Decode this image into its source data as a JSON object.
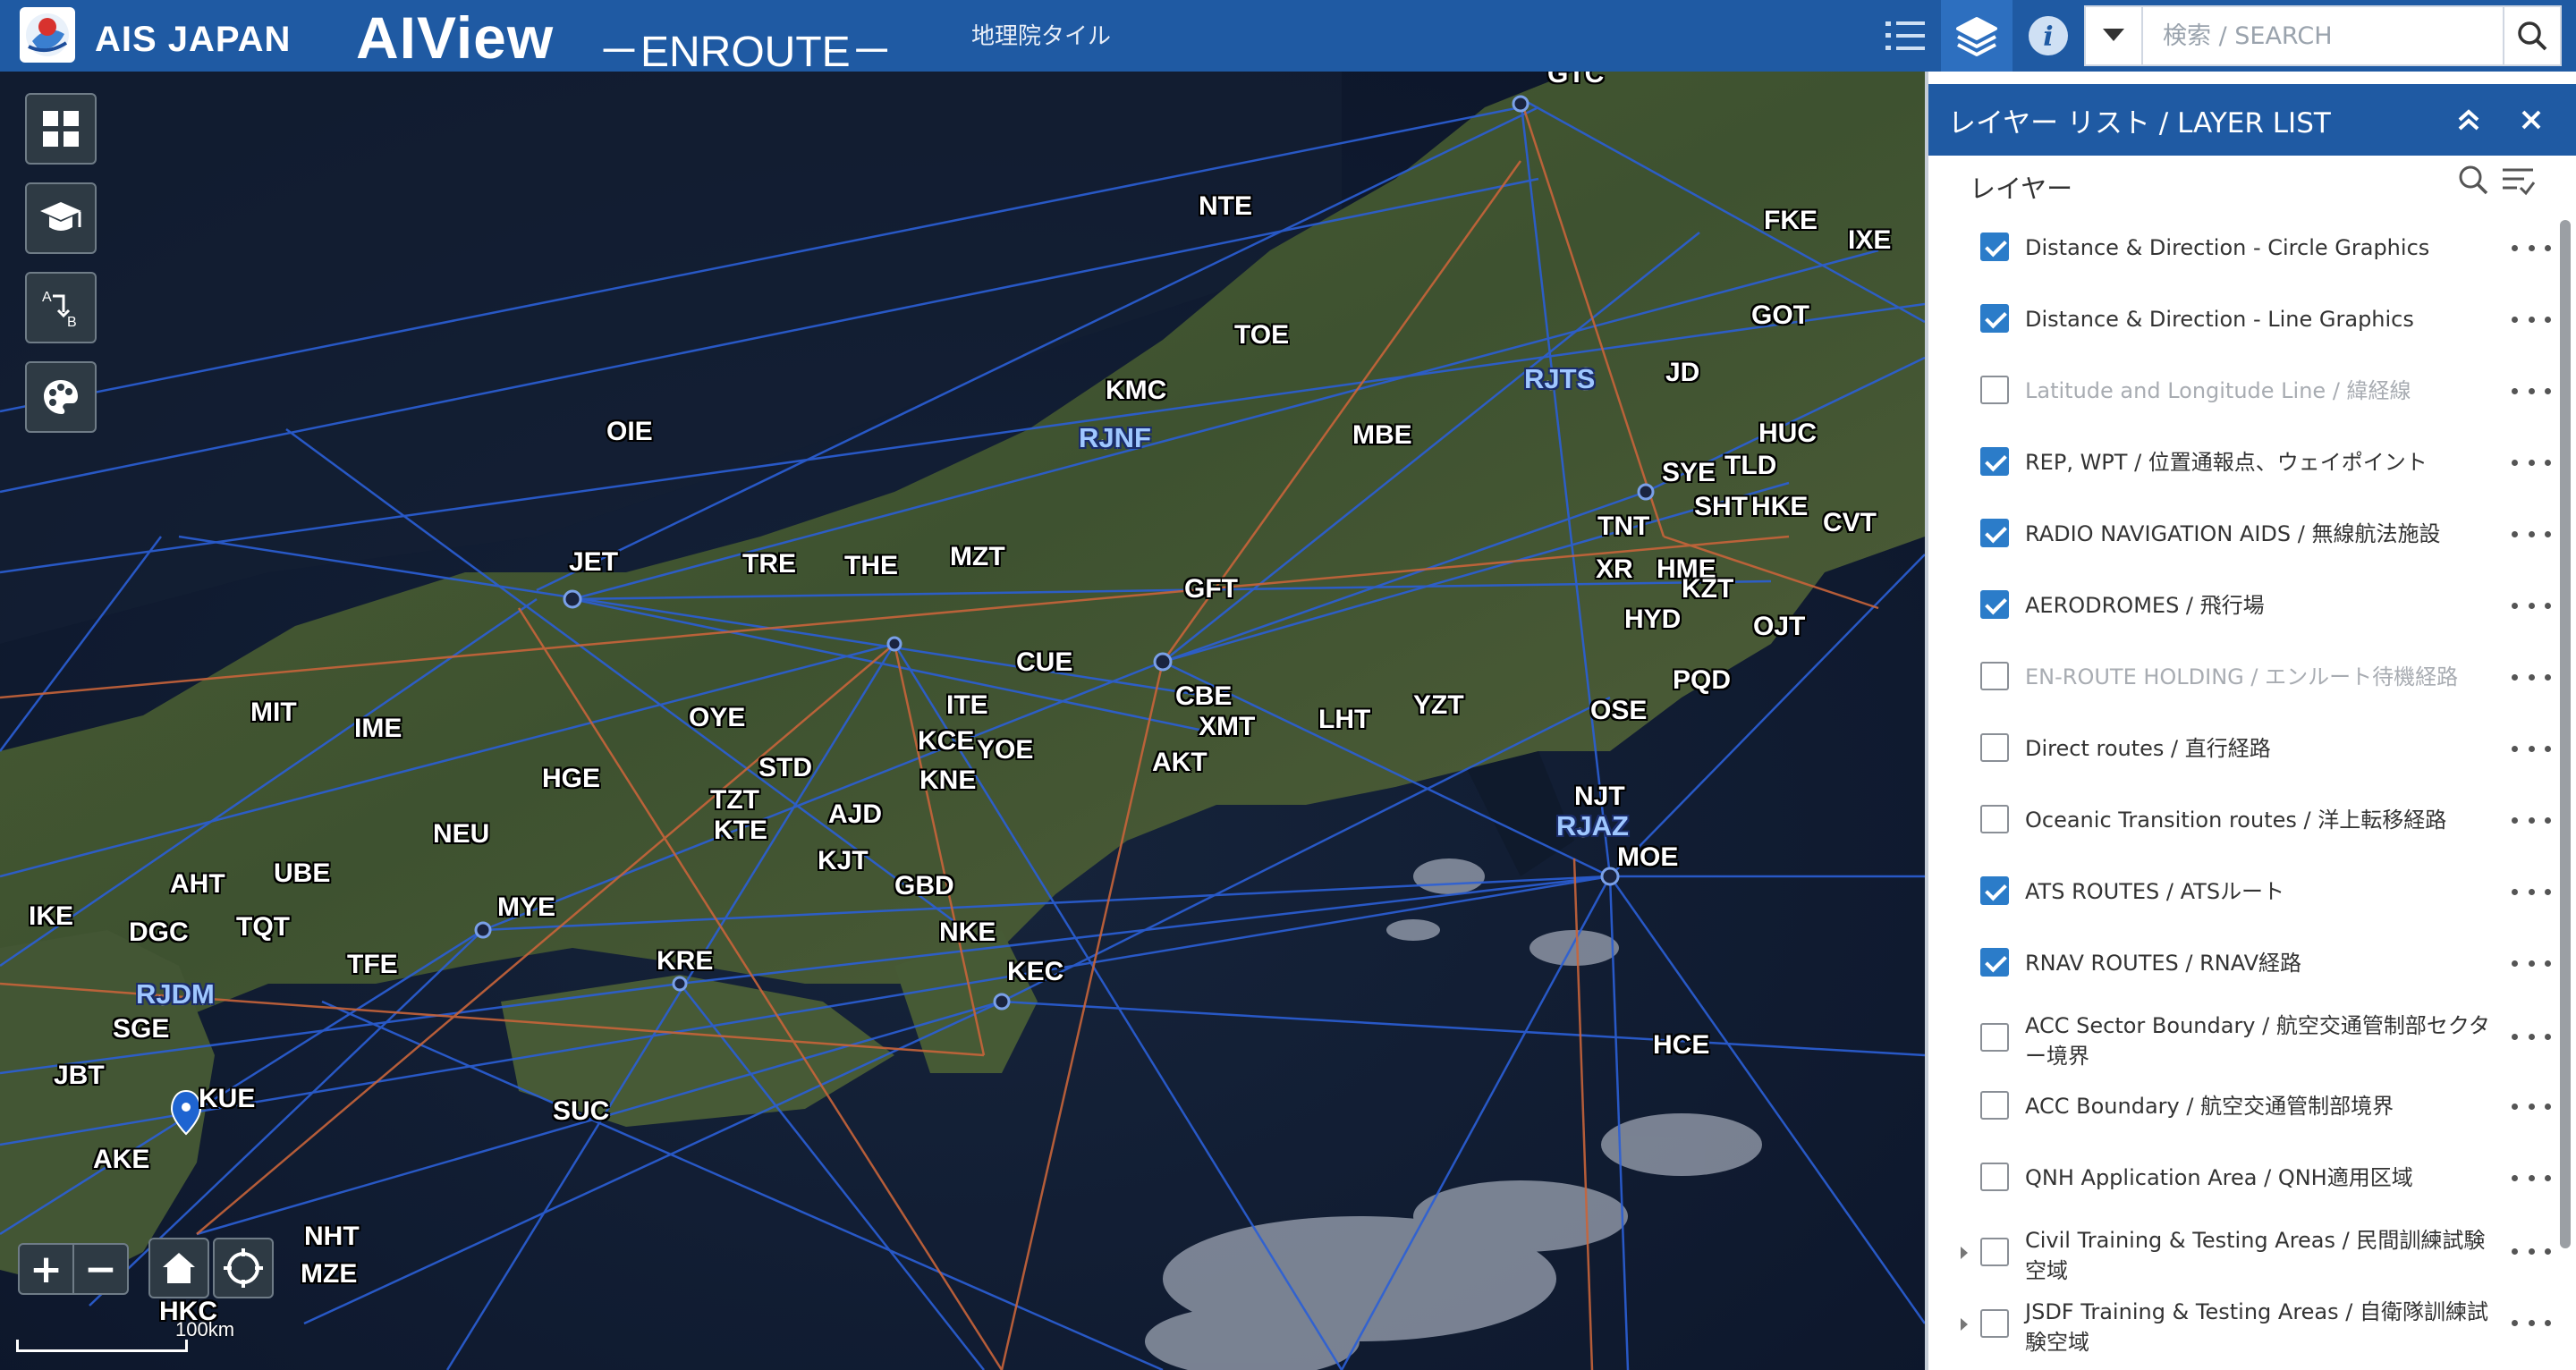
{
  "header": {
    "brand": "AIS JAPAN",
    "app_title": "AIView",
    "app_subtitle": "－ENROUTE－",
    "basemap_label": "地理院タイル",
    "search_placeholder": "検索 / SEARCH"
  },
  "colors": {
    "header_blue": "#1f5aa3",
    "active_blue": "#2d6fbf",
    "route_blue": "#2b5fd6",
    "route_orange": "#c8643a",
    "checkbox_blue": "#2b7cc9"
  },
  "map": {
    "scale_label": "100km",
    "waypoints": [
      "GTC",
      "NTE",
      "FKE",
      "IXE",
      "GOT",
      "TOE",
      "RJTS",
      "JD",
      "KMC",
      "RJNF",
      "MBE",
      "HUC",
      "OIE",
      "SYE",
      "TLD",
      "SHT",
      "HKE",
      "CVT",
      "TNT",
      "JET",
      "TRE",
      "THE",
      "MZT",
      "GFT",
      "XR",
      "HME",
      "KZT",
      "HYD",
      "OJT",
      "CUE",
      "PQD",
      "MIT",
      "IME",
      "OYE",
      "ITE",
      "CBE",
      "XMT",
      "LHT",
      "YZT",
      "OSE",
      "KCE",
      "YOE",
      "STD",
      "KNE",
      "AKT",
      "HGE",
      "TZT",
      "KTE",
      "AJD",
      "NEU",
      "KJT",
      "NJT",
      "RJAZ",
      "MOE",
      "AHT",
      "UBE",
      "GBD",
      "IKE",
      "DGC",
      "TQT",
      "MYE",
      "NKE",
      "TFE",
      "KRE",
      "KEC",
      "RJDM",
      "SGE",
      "HCE",
      "JBT",
      "KUE",
      "SUC",
      "AKE",
      "NHT",
      "MZE",
      "HKC"
    ],
    "icons": [
      "grid-icon",
      "education-icon",
      "route-ab-icon",
      "palette-icon"
    ]
  },
  "panel": {
    "title": "レイヤー リスト / LAYER LIST",
    "layers_label": "レイヤー",
    "layers": [
      {
        "name": "Distance & Direction - Circle Graphics",
        "checked": true,
        "dim": false,
        "expandable": false
      },
      {
        "name": "Distance & Direction - Line Graphics",
        "checked": true,
        "dim": false,
        "expandable": false
      },
      {
        "name": "Latitude and Longitude Line / 緯経線",
        "checked": false,
        "dim": true,
        "expandable": false
      },
      {
        "name": "REP, WPT / 位置通報点、ウェイポイント",
        "checked": true,
        "dim": false,
        "expandable": false
      },
      {
        "name": "RADIO NAVIGATION AIDS / 無線航法施設",
        "checked": true,
        "dim": false,
        "expandable": false
      },
      {
        "name": "AERODROMES / 飛行場",
        "checked": true,
        "dim": false,
        "expandable": false
      },
      {
        "name": "EN-ROUTE HOLDING / エンルート待機経路",
        "checked": false,
        "dim": true,
        "expandable": false
      },
      {
        "name": "Direct routes / 直行経路",
        "checked": false,
        "dim": false,
        "expandable": false
      },
      {
        "name": "Oceanic Transition routes / 洋上転移経路",
        "checked": false,
        "dim": false,
        "expandable": false
      },
      {
        "name": "ATS ROUTES / ATSルート",
        "checked": true,
        "dim": false,
        "expandable": false
      },
      {
        "name": "RNAV ROUTES / RNAV経路",
        "checked": true,
        "dim": false,
        "expandable": false
      },
      {
        "name": "ACC Sector Boundary / 航空交通管制部セクター境界",
        "checked": false,
        "dim": false,
        "expandable": false
      },
      {
        "name": "ACC Boundary / 航空交通管制部境界",
        "checked": false,
        "dim": false,
        "expandable": false
      },
      {
        "name": "QNH Application Area / QNH適用区域",
        "checked": false,
        "dim": false,
        "expandable": false
      },
      {
        "name": "Civil Training & Testing Areas / 民間訓練試験空域",
        "checked": false,
        "dim": false,
        "expandable": true
      },
      {
        "name": "JSDF Training & Testing Areas / 自衛隊訓練試験空域",
        "checked": false,
        "dim": false,
        "expandable": true
      }
    ]
  }
}
